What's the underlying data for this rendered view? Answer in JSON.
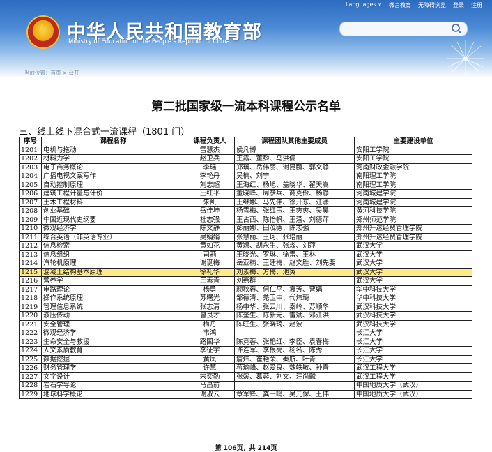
{
  "header": {
    "top_nav": [
      "Languages ∨",
      "微言教育",
      "无障碍浏览",
      "登录",
      "注册"
    ],
    "title_cn": "中华人民共和国教育部",
    "title_en": "Ministry of Education of the People's Republic of China",
    "breadcrumb": "当前位置：首页 > 公开",
    "search_placeholder": ""
  },
  "document": {
    "title": "第二批国家级一流本科课程公示名单",
    "section": "三、线上线下混合式一流课程（1801 门）",
    "columns": [
      "序号",
      "课程名称",
      "课程负责人",
      "课程团队其他主要成员",
      "主要建设单位"
    ],
    "rows": [
      [
        "1201",
        "电机与拖动",
        "雷慧杰",
        "侯凡博",
        "安阳工学院"
      ],
      [
        "1202",
        "材料力学",
        "赵卫兵",
        "王霞、董黎、马洪儒",
        "安阳工学院"
      ],
      [
        "1203",
        "电子商务概论",
        "李瑶",
        "郑璞、岳伟丽、谢昆鹏、郭文静",
        "河南财政金融学院"
      ],
      [
        "1204",
        "广播电视文案写作",
        "李艳丹",
        "吴楠、刘宁",
        "南阳理工学院"
      ],
      [
        "1205",
        "自动控制原理",
        "刘忠超",
        "王海红、杨旭、盖晓华、翟天嵩",
        "南阳理工学院"
      ],
      [
        "1206",
        "建筑工程计量与计价",
        "王红平",
        "董晓峰、周彦兵、商克俭、杨静",
        "河南城建学院"
      ],
      [
        "1207",
        "土木工程材料",
        "朱凯",
        "王继娜、马先伟、徐开东、汪潇",
        "河南城建学院"
      ],
      [
        "1208",
        "创业基础",
        "岳佳坤",
        "杨雪梅、张红玉、王爽爽、吴昊",
        "黄河科技学院"
      ],
      [
        "1209",
        "中国近现代史纲要",
        "杜志强",
        "王占西、陈怡帆、王滢、刘德萍",
        "郑州师范学院"
      ],
      [
        "1210",
        "微观经济学",
        "陈文静",
        "彭丽娜、田茂德、陈志强",
        "郑州升达经贸管理学院"
      ],
      [
        "1211",
        "综合英语（非英语专业）",
        "吴娟娟",
        "张慧丽、王珂、张培丽",
        "郑州升达经贸管理学院"
      ],
      [
        "1212",
        "信息检索",
        "黄如花",
        "黄颖、胡永生、张淼、刘萍",
        "武汉大学"
      ],
      [
        "1213",
        "信息组织",
        "司莉",
        "王晓光、罗琳、徐雷、王林",
        "武汉大学"
      ],
      [
        "1214",
        "汽轮机原理",
        "谢诞梅",
        "岳亚楠、王建梅、赵文胜、刘先斐",
        "武汉大学"
      ],
      [
        "1215",
        "混凝土结构基本原理",
        "徐礼华",
        "刘素梅、方梅、池寅",
        "武汉大学"
      ],
      [
        "1216",
        "营养学",
        "王素青",
        "刘燕群",
        "武汉大学"
      ],
      [
        "1217",
        "电路理论",
        "杨勇",
        "颜秋容、何仁平、袁芳、曹娟",
        "华中科技大学"
      ],
      [
        "1218",
        "操作系统原理",
        "苏曙光",
        "邹德清、羌卫中、代炜琦",
        "华中科技大学"
      ],
      [
        "1219",
        "管理信息系统",
        "张志清",
        "杨中华、张云川、秦岭、苏顺华",
        "武汉科技大学"
      ],
      [
        "1220",
        "液压传动",
        "曾良才",
        "陈奎生、陈新元、雷斌、邓江洪",
        "武汉科技大学"
      ],
      [
        "1221",
        "安全管理",
        "梅丹",
        "陈旺生、张晓琦、赵波",
        "武汉科技大学"
      ],
      [
        "1222",
        "微观经济学",
        "韦鸿",
        "",
        "长江大学"
      ],
      [
        "1223",
        "生命安全与救援",
        "路国华",
        "陈竟蓉、张艳红、李臣、袁春梅",
        "长江大学"
      ],
      [
        "1224",
        "人文素质教育",
        "李征宇",
        "许连军、李根亮、杨名、陈秀",
        "长江大学"
      ],
      [
        "1225",
        "数据挖掘",
        "黄凤",
        "詹炜、崔艳荣、秦航、叶青",
        "长江大学"
      ],
      [
        "1226",
        "财务管理学",
        "许慧",
        "蒋瑜峰、赵爱良、魏轶敏、孙青",
        "武汉工程大学"
      ],
      [
        "1227",
        "文字设计",
        "宋奕勤",
        "张媛、葛蓉、刘文、汪尚麟",
        "武汉工程大学"
      ],
      [
        "1228",
        "岩石学导论",
        "马昌前",
        "",
        "中国地质大学（武汉）"
      ],
      [
        "1229",
        "地球科学概论",
        "谢淑云",
        "章军锋、龚一鸣、吴元保、王伟",
        "中国地质大学（武汉）"
      ]
    ],
    "highlighted_row": "1215",
    "footer": "第 106页，共 214页"
  },
  "colors": {
    "header_blue": "#2d6bbf",
    "highlight": "#ffe98a"
  }
}
